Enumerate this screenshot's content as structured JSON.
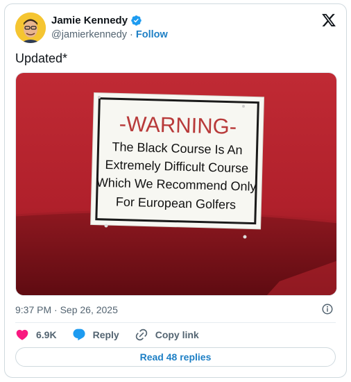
{
  "author": {
    "name": "Jamie Kennedy",
    "handle": "@jamierkennedy",
    "separator": "·",
    "follow_label": "Follow"
  },
  "tweet": {
    "text": "Updated*"
  },
  "media": {
    "sign": {
      "heading": "-WARNING-",
      "line1": "The Black Course Is An",
      "line2": "Extremely Difficult Course",
      "line3": "Which We Recommend Only",
      "line4": "For European Golfers"
    },
    "colors": {
      "background": "#b5252f",
      "heading": "#b83a3a"
    }
  },
  "meta": {
    "timestamp": "9:37 PM · Sep 26, 2025"
  },
  "actions": {
    "likes": "6.9K",
    "reply_label": "Reply",
    "copy_link_label": "Copy link"
  },
  "footer": {
    "read_replies_label": "Read 48 replies"
  },
  "icons": [
    "verified-badge-icon",
    "x-logo-icon",
    "info-icon",
    "heart-icon",
    "reply-bubble-icon",
    "link-icon"
  ],
  "colors": {
    "accent": "#1d7fc5",
    "like": "#f91880",
    "verified": "#1d9bf0"
  }
}
